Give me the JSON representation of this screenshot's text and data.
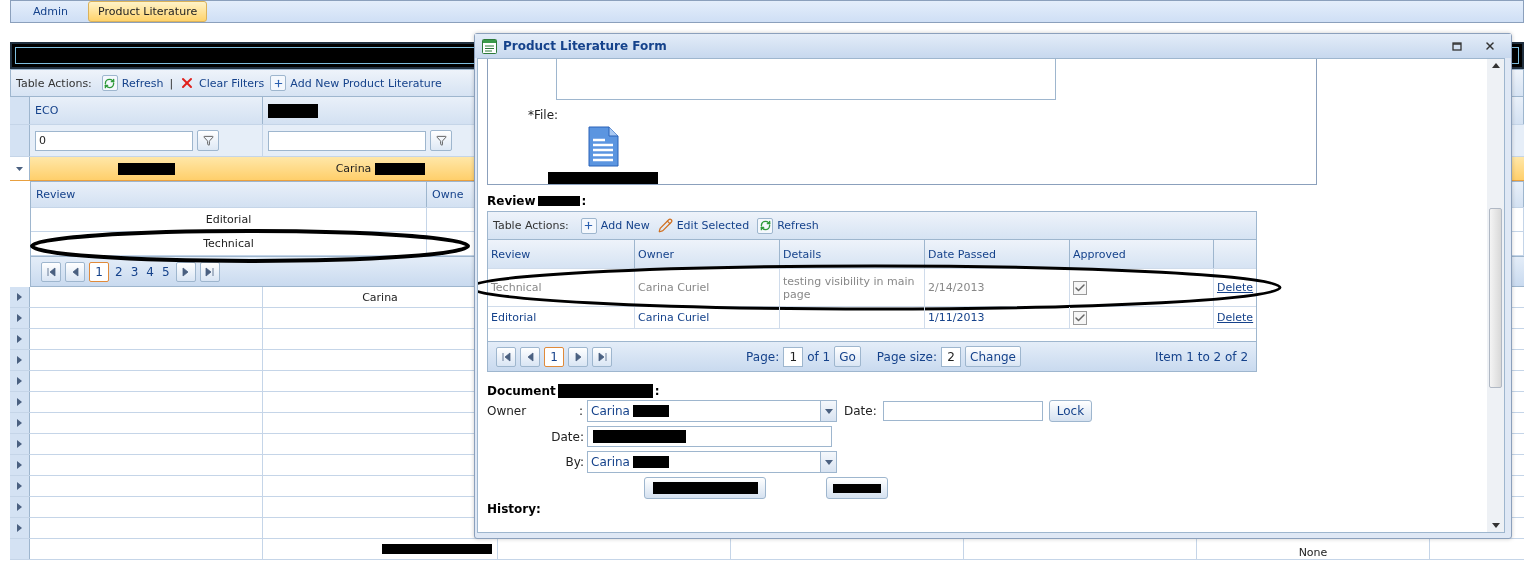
{
  "nav_tabs": [
    {
      "label": "Admin",
      "selected": false
    },
    {
      "label": "Product Literature",
      "selected": true
    }
  ],
  "grid": {
    "toolbar": {
      "label": "Table Actions:",
      "separator": "|",
      "actions": [
        {
          "kind": "refresh",
          "label": "Refresh"
        },
        {
          "kind": "clear",
          "label": "Clear Filters"
        },
        {
          "kind": "add",
          "label": "Add New Product Literature"
        }
      ]
    },
    "columns": [
      "ECO"
    ],
    "filter_value": "0",
    "group_row": {
      "expanded": true,
      "owner": "Carina"
    },
    "detail": {
      "columns": [
        "Review",
        "Owne"
      ],
      "rows": [
        "Editorial",
        "Technical"
      ],
      "pages": [
        {
          "label": "1",
          "selected": true
        },
        {
          "label": "2",
          "selected": false
        },
        {
          "label": "3",
          "selected": false
        },
        {
          "label": "4",
          "selected": false
        },
        {
          "label": "5",
          "selected": false
        }
      ]
    },
    "rows": [
      {
        "expanded": false,
        "column_2": "Carina"
      },
      {
        "expanded": false
      },
      {
        "expanded": false
      },
      {
        "expanded": false
      },
      {
        "expanded": false
      },
      {
        "expanded": false
      },
      {
        "expanded": false
      },
      {
        "expanded": false
      },
      {
        "expanded": false
      },
      {
        "expanded": false
      },
      {
        "expanded": false
      },
      {
        "expanded": false
      }
    ],
    "last_row": {
      "column_6": "None"
    }
  },
  "dialog": {
    "title": "Product Literature Form",
    "file_label": "*File:",
    "review": {
      "heading": "Review",
      "heading_suffix": ":",
      "toolbar": {
        "label": "Table Actions:",
        "actions": [
          {
            "kind": "add",
            "label": "Add New"
          },
          {
            "kind": "edit",
            "label": "Edit Selected"
          },
          {
            "kind": "refresh",
            "label": "Refresh"
          }
        ]
      },
      "columns": [
        "Review",
        "Owner",
        "Details",
        "Date Passed",
        "Approved"
      ],
      "rows": [
        {
          "review": "Technical",
          "owner": "Carina Curiel",
          "details": "testing visibility in main page",
          "date_passed": "2/14/2013",
          "approved": true,
          "disabled": true,
          "action": "Delete"
        },
        {
          "review": "Editorial",
          "owner": "Carina Curiel",
          "details": null,
          "date_passed": "1/11/2013",
          "approved": true,
          "disabled": false,
          "action": "Delete"
        }
      ],
      "pager": {
        "pages": [
          {
            "label": "1",
            "selected": true
          }
        ],
        "page_label": "Page:",
        "page": "1",
        "of": "of 1",
        "go": "Go",
        "size_label": "Page size:",
        "size": "2",
        "change": "Change",
        "summary": "Item 1 to 2 of 2"
      }
    },
    "document": {
      "heading": "Document",
      "heading_suffix": ":",
      "owner_label": "Owner",
      "owner_colon": ":",
      "owner": "Carina",
      "date_label": "Date:",
      "lock": "Lock",
      "date2_label": "Date:",
      "by_label": "By:",
      "by": "Carina"
    },
    "history_heading": "History:"
  }
}
